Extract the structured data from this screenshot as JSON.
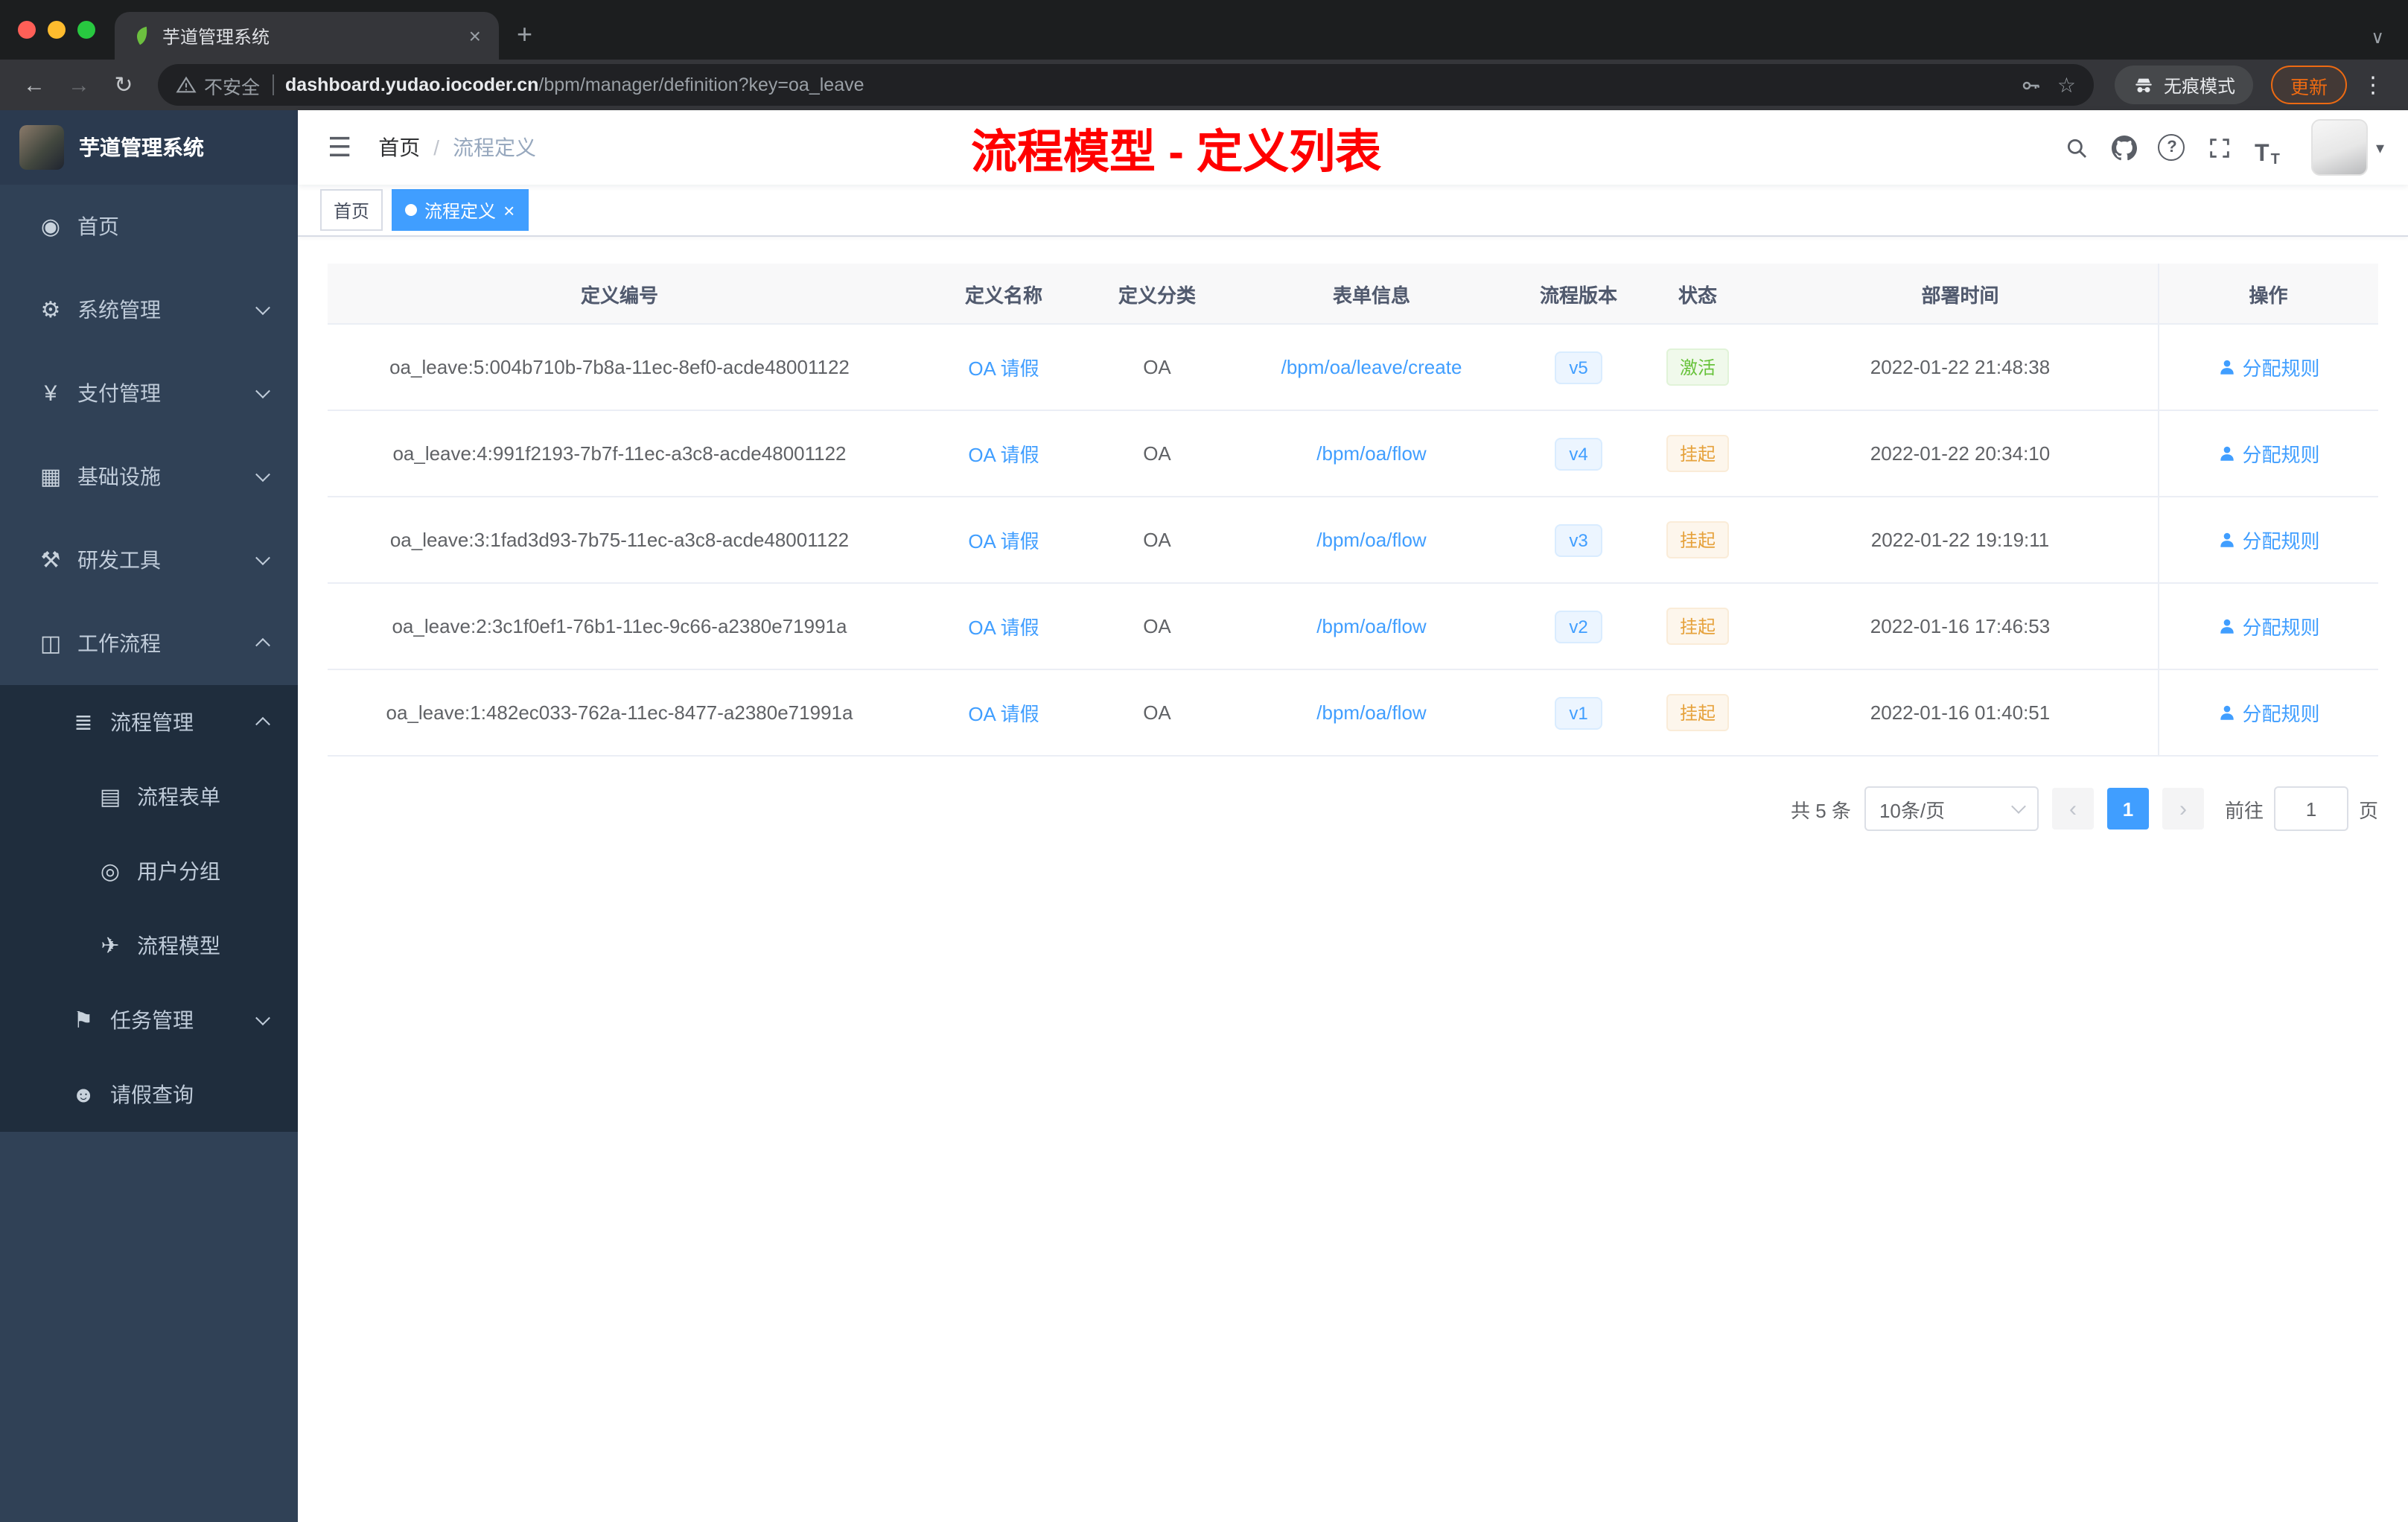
{
  "browser": {
    "tab_title": "芋道管理系统",
    "security_label": "不安全",
    "url_domain": "dashboard.yudao.iocoder.cn",
    "url_path": "/bpm/manager/definition?key=oa_leave",
    "incognito_label": "无痕模式",
    "update_label": "更新"
  },
  "icons": {
    "dashboard": "◉",
    "system": "⚙",
    "payment": "¥",
    "infra": "▦",
    "devtools": "⚒",
    "workflow": "◫",
    "process": "≣",
    "form": "▤",
    "group": "◎",
    "model": "✈",
    "task": "⚑",
    "leave": "☻",
    "hamburger": "☰",
    "back": "←",
    "forward": "→",
    "reload": "↻",
    "star": "☆",
    "dots": "⋮",
    "close": "×",
    "plus": "+",
    "tabsearch": "∨",
    "caret": "▾",
    "question": "?",
    "fontsize": "T",
    "prev": "‹",
    "next": "›"
  },
  "sidebar": {
    "title": "芋道管理系统",
    "items": [
      {
        "label": "首页"
      },
      {
        "label": "系统管理"
      },
      {
        "label": "支付管理"
      },
      {
        "label": "基础设施"
      },
      {
        "label": "研发工具"
      },
      {
        "label": "工作流程"
      },
      {
        "label": "流程管理"
      },
      {
        "label": "流程表单"
      },
      {
        "label": "用户分组"
      },
      {
        "label": "流程模型"
      },
      {
        "label": "任务管理"
      },
      {
        "label": "请假查询"
      }
    ]
  },
  "navbar": {
    "breadcrumb_home": "首页",
    "breadcrumb_sep": "/",
    "breadcrumb_current": "流程定义",
    "annotation": "流程模型 - 定义列表"
  },
  "tags": {
    "home": "首页",
    "active": "流程定义"
  },
  "table": {
    "columns": [
      "定义编号",
      "定义名称",
      "定义分类",
      "表单信息",
      "流程版本",
      "状态",
      "部署时间",
      "操作"
    ],
    "rows": [
      {
        "id": "oa_leave:5:004b710b-7b8a-11ec-8ef0-acde48001122",
        "name": "OA 请假",
        "category": "OA",
        "form": "/bpm/oa/leave/create",
        "version": "v5",
        "status": "激活",
        "status_type": "success",
        "time": "2022-01-22 21:48:38",
        "action": "分配规则"
      },
      {
        "id": "oa_leave:4:991f2193-7b7f-11ec-a3c8-acde48001122",
        "name": "OA 请假",
        "category": "OA",
        "form": "/bpm/oa/flow",
        "version": "v4",
        "status": "挂起",
        "status_type": "warning",
        "time": "2022-01-22 20:34:10",
        "action": "分配规则"
      },
      {
        "id": "oa_leave:3:1fad3d93-7b75-11ec-a3c8-acde48001122",
        "name": "OA 请假",
        "category": "OA",
        "form": "/bpm/oa/flow",
        "version": "v3",
        "status": "挂起",
        "status_type": "warning",
        "time": "2022-01-22 19:19:11",
        "action": "分配规则"
      },
      {
        "id": "oa_leave:2:3c1f0ef1-76b1-11ec-9c66-a2380e71991a",
        "name": "OA 请假",
        "category": "OA",
        "form": "/bpm/oa/flow",
        "version": "v2",
        "status": "挂起",
        "status_type": "warning",
        "time": "2022-01-16 17:46:53",
        "action": "分配规则"
      },
      {
        "id": "oa_leave:1:482ec033-762a-11ec-8477-a2380e71991a",
        "name": "OA 请假",
        "category": "OA",
        "form": "/bpm/oa/flow",
        "version": "v1",
        "status": "挂起",
        "status_type": "warning",
        "time": "2022-01-16 01:40:51",
        "action": "分配规则"
      }
    ]
  },
  "pagination": {
    "total": "共 5 条",
    "page_size": "10条/页",
    "current_page": "1",
    "goto_label": "前往",
    "goto_value": "1",
    "goto_unit": "页"
  },
  "colors": {
    "primary": "#409eff",
    "success": "#67c23a",
    "warning": "#e6a23c",
    "annotation_red": "#ff0000",
    "sidebar_bg": "#304156",
    "sidebar_sub_bg": "#1f2d3d"
  }
}
